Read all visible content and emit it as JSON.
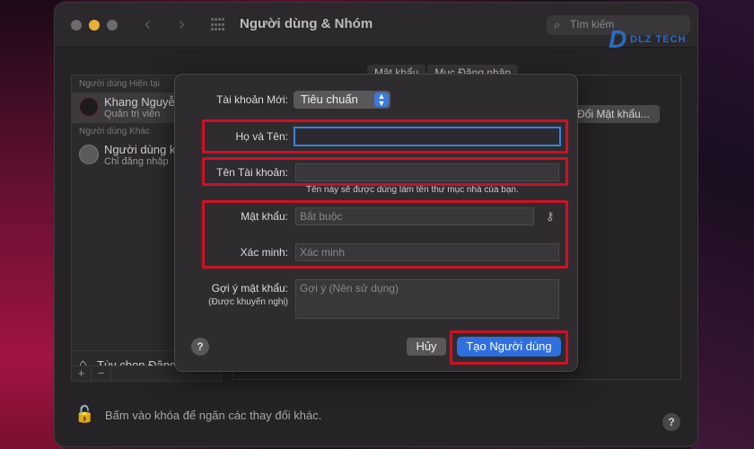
{
  "window": {
    "title": "Người dùng & Nhóm",
    "search_placeholder": "Tìm kiếm",
    "logo_text": "DLZ TECH"
  },
  "sidebar": {
    "current_section": "Người dùng Hiện tại",
    "current_user": {
      "name": "Khang Nguyễn",
      "role": "Quản trị viên"
    },
    "other_section": "Người dùng Khác",
    "other_user": {
      "name": "Người dùng khác",
      "role": "Chỉ đăng nhập"
    },
    "login_options": "Tùy chọn Đăng nhập",
    "add": "+",
    "remove": "−"
  },
  "right_pane": {
    "tabs": [
      "Mật khẩu",
      "Mục Đăng nhập"
    ],
    "change_password": "Đổi Mật khẩu..."
  },
  "footer": {
    "lock_text": "Bấm vào khóa để ngăn các thay đổi khác.",
    "help": "?"
  },
  "dialog": {
    "account_type_label": "Tài khoản Mới:",
    "account_type_value": "Tiêu chuẩn",
    "fullname_label": "Họ và Tên:",
    "fullname_value": "",
    "account_name_label": "Tên Tài khoản:",
    "account_name_value": "",
    "account_name_hint": "Tên này sẽ được dùng làm tên thư mục nhà của bạn.",
    "password_label": "Mật khẩu:",
    "password_placeholder": "Bắt buộc",
    "verify_label": "Xác minh:",
    "verify_placeholder": "Xác minh",
    "hint_label": "Gợi ý mật khẩu:",
    "hint_sublabel": "(Được khuyến nghị)",
    "hint_placeholder": "Gợi ý (Nên sử dụng)",
    "help": "?",
    "cancel": "Hủy",
    "create": "Tạo Người dùng"
  },
  "colors": {
    "accent": "#2f6fe0",
    "highlight_box": "#d01023"
  }
}
